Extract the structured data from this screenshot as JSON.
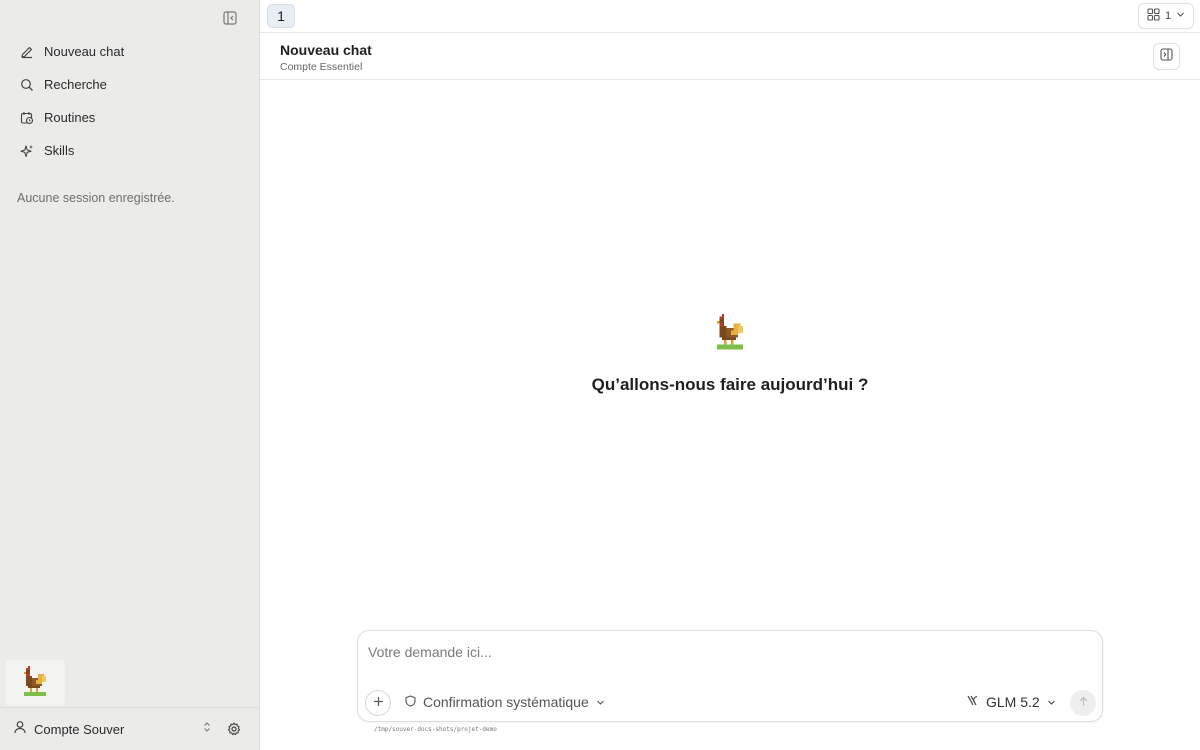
{
  "topbar": {
    "tab_label": "1",
    "grid_count": "1"
  },
  "sidebar": {
    "items": [
      {
        "label": "Nouveau chat",
        "icon": "pencil-icon"
      },
      {
        "label": "Recherche",
        "icon": "search-icon"
      },
      {
        "label": "Routines",
        "icon": "calendar-clock-icon"
      },
      {
        "label": "Skills",
        "icon": "sparkle-icon"
      }
    ],
    "empty_sessions": "Aucune session enregistrée.",
    "account_name": "Compte Souver"
  },
  "header": {
    "title": "Nouveau chat",
    "subtitle": "Compte Essentiel"
  },
  "main": {
    "greeting": "Qu’allons-nous faire aujourd’hui ?"
  },
  "composer": {
    "placeholder": "Votre demande ici...",
    "confirmation_mode": "Confirmation systématique",
    "model": "GLM 5.2"
  },
  "footer": {
    "working_directory": "/tmp/souver-docs-shots/projet-demo"
  },
  "colors": {
    "sidebar_bg": "#ebebe9",
    "accent_chip": "#e8eef5",
    "mascot_brown": "#7a4a1e",
    "mascot_grass": "#7bbf4a"
  }
}
